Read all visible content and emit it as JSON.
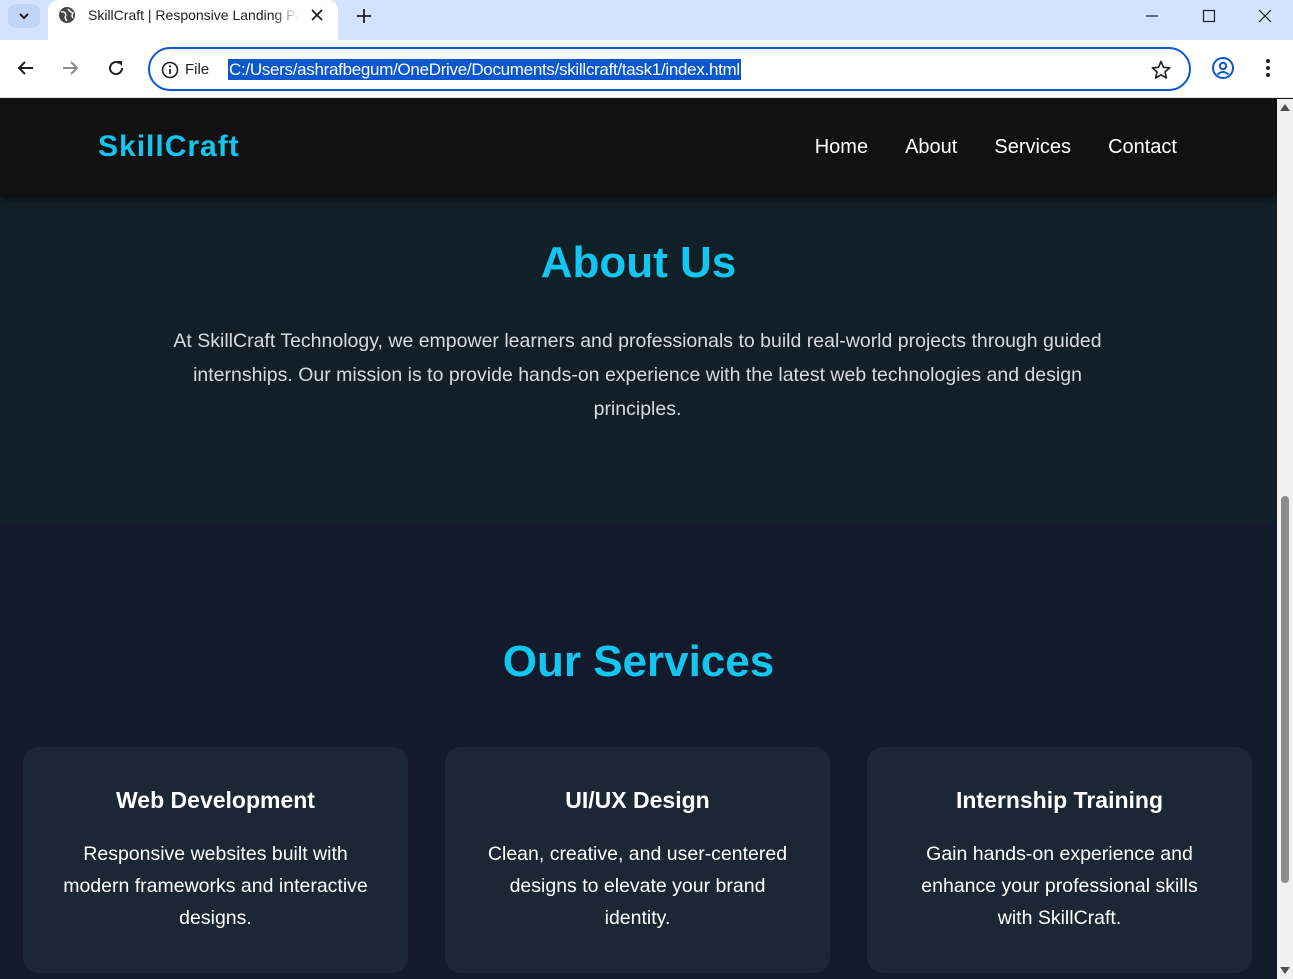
{
  "browser": {
    "tab_title": "SkillCraft | Responsive Landing Page",
    "omnibox_scheme_label": "File",
    "url": "C:/Users/ashrafbegum/OneDrive/Documents/skillcraft/task1/index.html",
    "icons": [
      "tab-search-icon",
      "globe-icon",
      "close-icon",
      "plus-icon",
      "minimize-icon",
      "maximize-icon",
      "back-arrow-icon",
      "forward-arrow-icon",
      "reload-icon",
      "info-icon",
      "star-icon",
      "profile-icon",
      "kebab-menu-icon"
    ]
  },
  "site": {
    "logo": "SkillCraft",
    "nav": [
      "Home",
      "About",
      "Services",
      "Contact"
    ],
    "accent_color": "#12c6ef"
  },
  "about": {
    "title": "About Us",
    "text": "At SkillCraft Technology, we empower learners and professionals to build real-world projects through guided internships. Our mission is to provide hands-on experience with the latest web technologies and design principles."
  },
  "services": {
    "title": "Our Services",
    "cards": [
      {
        "title": "Web Development",
        "desc": "Responsive websites built with modern frameworks and interactive designs."
      },
      {
        "title": "UI/UX Design",
        "desc": "Clean, creative, and user-centered designs to elevate your brand identity."
      },
      {
        "title": "Internship Training",
        "desc": "Gain hands-on experience and enhance your professional skills with SkillCraft."
      }
    ]
  }
}
